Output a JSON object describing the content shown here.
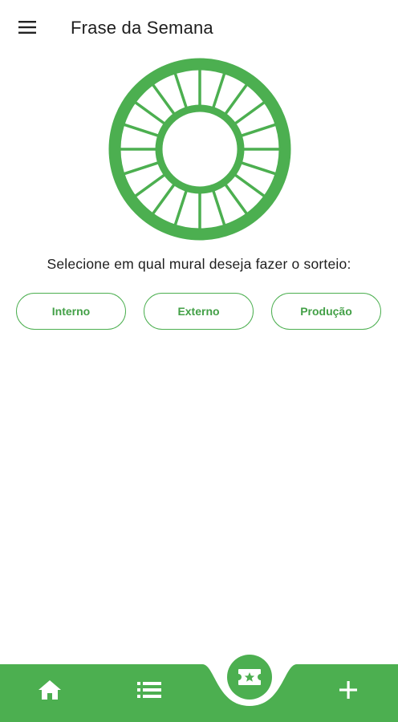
{
  "appbar": {
    "title": "Frase da Semana",
    "menu_icon": "hamburger-menu-icon"
  },
  "main": {
    "wheel_icon": "prize-wheel-icon",
    "prompt": "Selecione em qual mural deseja fazer o sorteio:",
    "options": [
      {
        "label": "Interno"
      },
      {
        "label": "Externo"
      },
      {
        "label": "Produção"
      }
    ]
  },
  "bottom_nav": {
    "items": [
      "home-icon",
      "list-icon",
      "ticket-star-icon",
      "add-icon"
    ]
  },
  "colors": {
    "accent": "#4caf50",
    "accent_text": "#43a047",
    "background": "#ffffff",
    "text": "#1e1e1e"
  }
}
